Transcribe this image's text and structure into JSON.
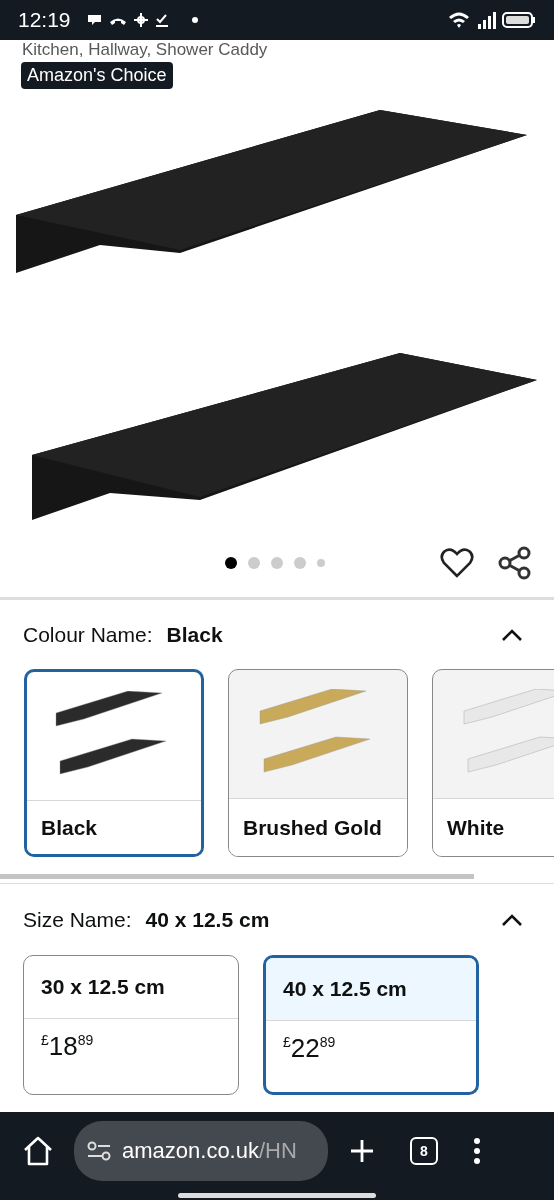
{
  "status_bar": {
    "time": "12:19"
  },
  "product": {
    "subtitle": "Kitchen, Hallway, Shower Caddy",
    "badge": "Amazon's Choice"
  },
  "gallery": {
    "dots": [
      {
        "selected": true
      },
      {
        "selected": false
      },
      {
        "selected": false
      },
      {
        "selected": false
      },
      {
        "selected": false
      }
    ]
  },
  "colour": {
    "label": "Colour Name:",
    "value": "Black",
    "expanded": true,
    "options": [
      {
        "name": "Black",
        "selected": true,
        "color": "#2b2b2b"
      },
      {
        "name": "Brushed Gold",
        "selected": false,
        "color": "#c9a95a"
      },
      {
        "name": "White",
        "selected": false,
        "color": "#e8e8e8"
      }
    ]
  },
  "size": {
    "label": "Size Name:",
    "value": "40 x 12.5 cm",
    "expanded": true,
    "options": [
      {
        "name": "30 x 12.5 cm",
        "price": "$^{£}$18$^{89}$",
        "selected": false
      },
      {
        "name": "40 x 12.5 cm",
        "price": "$^{£}$22$^{89}$",
        "selected": true
      }
    ]
  },
  "browser": {
    "host": "amazon.co.uk",
    "path": "/HN",
    "tab_count": "8"
  }
}
